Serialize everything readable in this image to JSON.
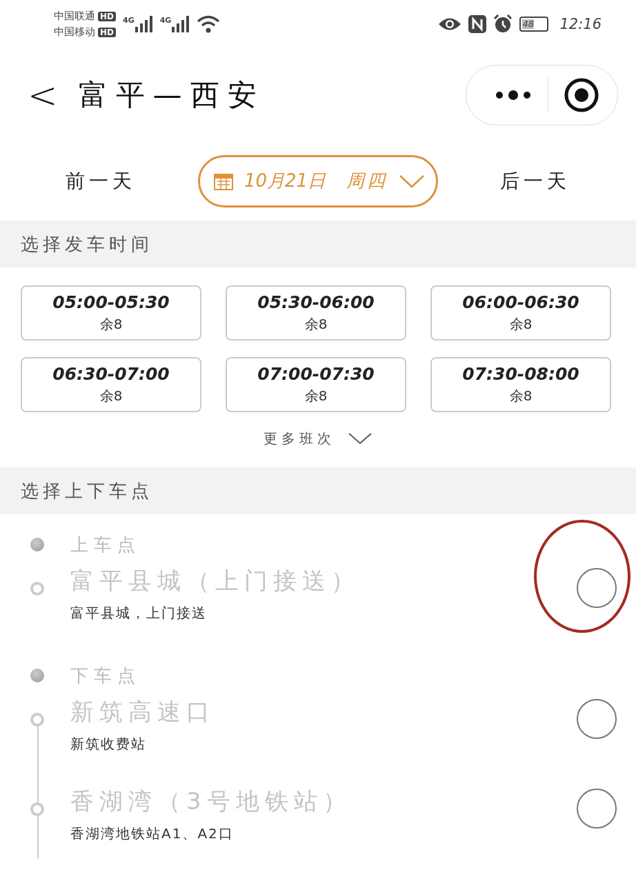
{
  "status_bar": {
    "carriers": [
      {
        "name": "中国联通",
        "badge": "HD"
      },
      {
        "name": "中国移动",
        "badge": "HD"
      }
    ],
    "networks": [
      "4G",
      "4G"
    ],
    "battery": "48",
    "time": "12:16"
  },
  "header": {
    "back": "<",
    "title": "富平—西安"
  },
  "date_bar": {
    "prev": "前一天",
    "date": "10月21日",
    "weekday": "周四",
    "next": "后一天"
  },
  "departure": {
    "title": "选择发车时间",
    "slots": [
      {
        "time": "05:00-05:30",
        "seats": "余8"
      },
      {
        "time": "05:30-06:00",
        "seats": "余8"
      },
      {
        "time": "06:00-06:30",
        "seats": "余8"
      },
      {
        "time": "06:30-07:00",
        "seats": "余8"
      },
      {
        "time": "07:00-07:30",
        "seats": "余8"
      },
      {
        "time": "07:30-08:00",
        "seats": "余8"
      }
    ],
    "more": "更多班次"
  },
  "stops": {
    "title": "选择上下车点",
    "items": [
      {
        "kind": "heading",
        "name": "上车点"
      },
      {
        "kind": "stop",
        "name": "富平县城（上门接送）",
        "detail": "富平县城，上门接送",
        "selected": false,
        "highlighted": true
      },
      {
        "kind": "heading",
        "name": "下车点"
      },
      {
        "kind": "stop",
        "name": "新筑高速口",
        "detail": "新筑收费站",
        "selected": false,
        "highlighted": false
      },
      {
        "kind": "stop",
        "name": "香湖湾（3号地铁站）",
        "detail": "香湖湾地铁站A1、A2口",
        "selected": false,
        "highlighted": false
      }
    ]
  }
}
